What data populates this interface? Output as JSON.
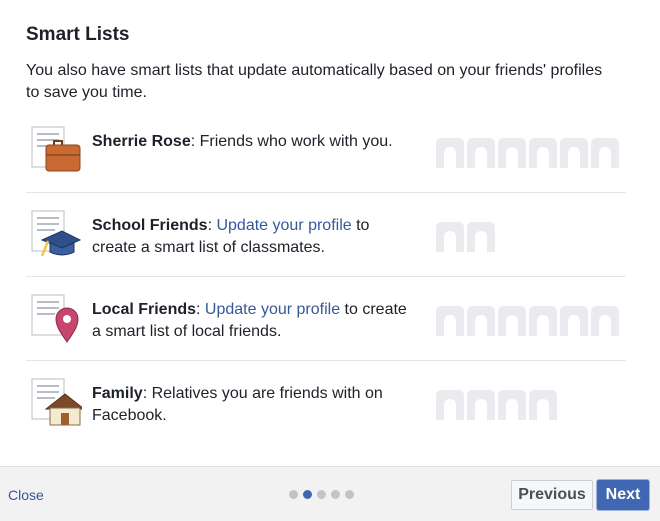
{
  "dialog": {
    "title": "Smart Lists",
    "intro": "You also have smart lists that update automatically based on your friends' profiles to save you time."
  },
  "rows": [
    {
      "name": "Sherrie Rose",
      "sep": ": ",
      "text_before_link": "Friends who work with you.",
      "link": "",
      "text_after_link": "",
      "icon": "briefcase-icon",
      "placeholder_count": 6
    },
    {
      "name": "School Friends",
      "sep": ": ",
      "text_before_link": "",
      "link": "Update your profile",
      "text_after_link": " to create a smart list of classmates.",
      "icon": "graduation-cap-icon",
      "placeholder_count": 2
    },
    {
      "name": "Local Friends",
      "sep": ": ",
      "text_before_link": "",
      "link": "Update your profile",
      "text_after_link": " to create a smart list of local friends.",
      "icon": "map-pin-icon",
      "placeholder_count": 6
    },
    {
      "name": "Family",
      "sep": ": ",
      "text_before_link": "Relatives you are friends with on Facebook.",
      "link": "",
      "text_after_link": "",
      "icon": "house-icon",
      "placeholder_count": 4
    }
  ],
  "footer": {
    "close_label": "Close",
    "previous_label": "Previous",
    "next_label": "Next",
    "page_count": 5,
    "current_page": 2
  },
  "colors": {
    "link": "#365899",
    "primary_button": "#4267b2",
    "placeholder": "#e9ebee"
  }
}
